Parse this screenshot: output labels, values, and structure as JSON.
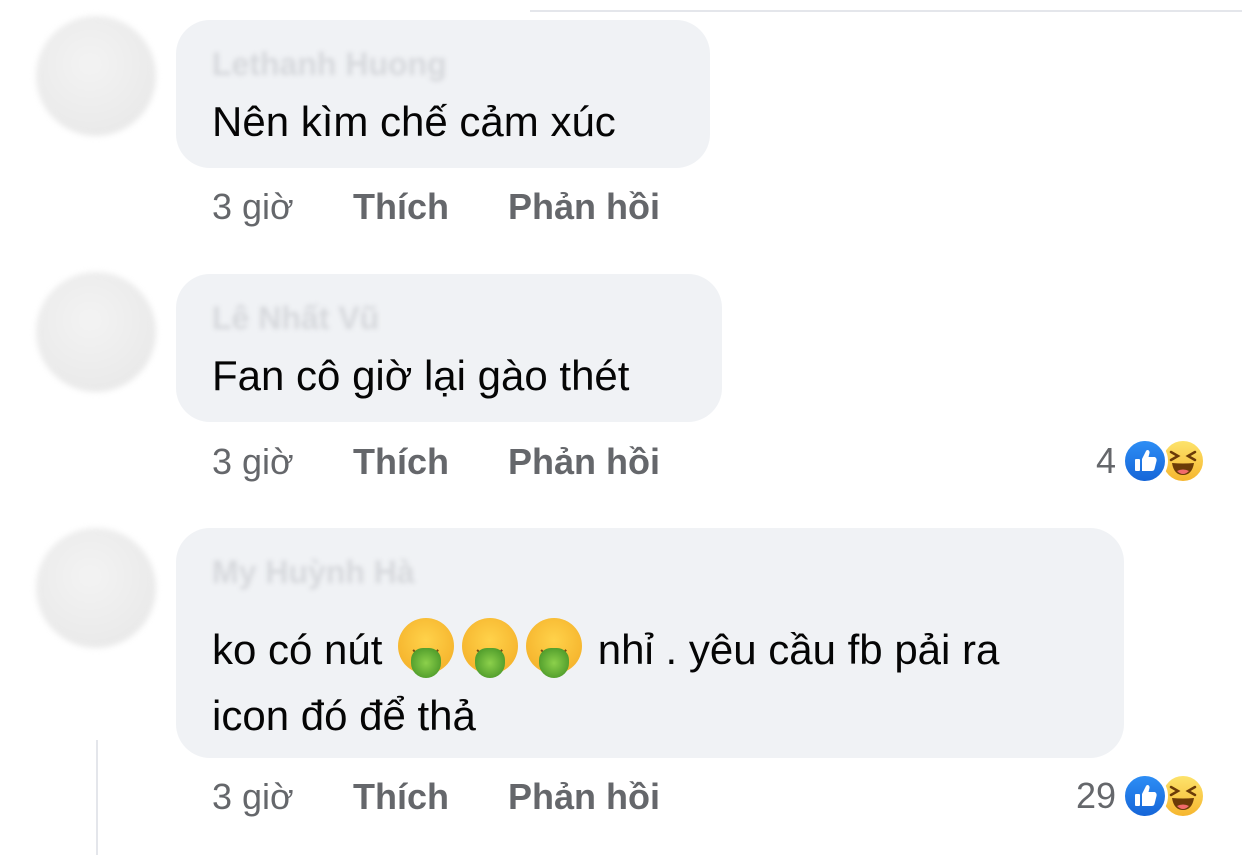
{
  "comments": [
    {
      "author": "Lethanh Huong",
      "text_parts": [
        "Nên kìm chế cảm xúc"
      ],
      "time": "3 giờ",
      "like": "Thích",
      "reply": "Phản hồi",
      "reaction_count": ""
    },
    {
      "author": "Lê Nhất Vũ",
      "text_parts": [
        "Fan cô giờ lại gào thét"
      ],
      "time": "3 giờ",
      "like": "Thích",
      "reply": "Phản hồi",
      "reaction_count": "4",
      "reaction_icons": [
        "like-icon",
        "haha-icon"
      ]
    },
    {
      "author": "My Huỳnh Hà",
      "text_line1_start": "ko có nút",
      "text_line1_emojis": [
        "face-vomiting-emoji",
        "face-vomiting-emoji",
        "face-vomiting-emoji"
      ],
      "text_line1_end": "nhỉ . yêu cầu fb pải ra",
      "text_line2": "icon đó để thả",
      "time": "3 giờ",
      "like": "Thích",
      "reply": "Phản hồi",
      "reaction_count": "29",
      "reaction_icons": [
        "like-icon",
        "haha-icon"
      ]
    }
  ],
  "colors": {
    "bubble": "#f0f2f5",
    "meta_text": "#65676b",
    "like_blue": "#1877f2",
    "haha_yellow": "#f7b928"
  }
}
